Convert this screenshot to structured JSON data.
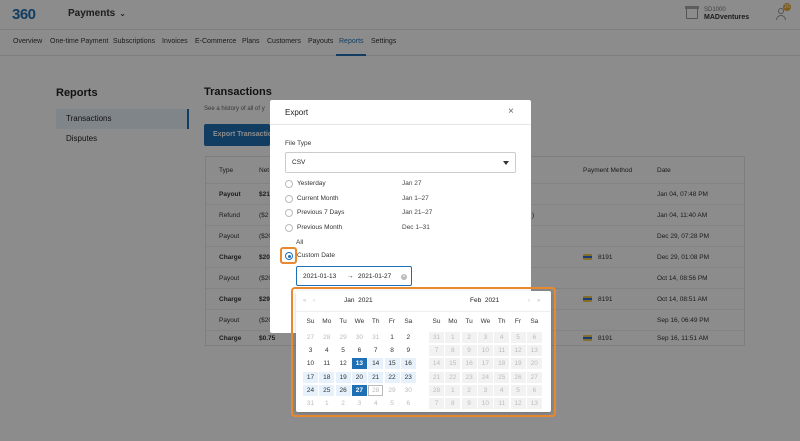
{
  "header": {
    "logo": "360",
    "app_name": "Payments",
    "account_id": "SD1000",
    "account_name": "MADventures",
    "notification_count": "20"
  },
  "nav": {
    "tabs": [
      "Overview",
      "One-time Payment",
      "Subscriptions",
      "Invoices",
      "E-Commerce",
      "Plans",
      "Customers",
      "Payouts",
      "Reports",
      "Settings"
    ],
    "active": "Reports"
  },
  "sidebar": {
    "title": "Reports",
    "items": [
      {
        "label": "Transactions"
      },
      {
        "label": "Disputes"
      }
    ]
  },
  "main": {
    "title": "Transactions",
    "subtitle": "See a history of all of y",
    "export_button": "Export Transactions"
  },
  "table": {
    "headers": [
      "Type",
      "Net",
      "Payment Method",
      "Date"
    ],
    "rows": [
      {
        "type": "Payout",
        "net": "$21",
        "pm": "",
        "date": "Jan 04, 07:48 PM",
        "bold": true
      },
      {
        "type": "Refund",
        "net": "($2",
        "pm": "",
        "date": "Jan 04, 11:40 AM",
        "bold": false,
        "extra": ")"
      },
      {
        "type": "Payout",
        "net": "($20",
        "pm": "",
        "date": "Dec 29, 07:28 PM",
        "bold": false
      },
      {
        "type": "Charge",
        "net": "$20",
        "pm": "8191",
        "date": "Dec 29, 01:08 PM",
        "bold": true
      },
      {
        "type": "Payout",
        "net": "($20",
        "pm": "",
        "date": "Oct 14, 08:56 PM",
        "bold": false
      },
      {
        "type": "Charge",
        "net": "$29",
        "pm": "8191",
        "date": "Oct 14, 08:51 AM",
        "bold": true
      },
      {
        "type": "Payout",
        "net": "($20",
        "pm": "",
        "date": "Sep 16, 06:49 PM",
        "bold": false
      },
      {
        "type": "Charge",
        "net": "$0.75",
        "pm": "8191",
        "date": "Sep 16, 11:51 AM",
        "bold": true
      }
    ]
  },
  "modal": {
    "title": "Export",
    "close": "×",
    "file_type_label": "File Type",
    "file_type_value": "CSV",
    "options": [
      {
        "label": "Yesterday",
        "range": "Jan 27"
      },
      {
        "label": "Current Month",
        "range": "Jan 1–27"
      },
      {
        "label": "Previous 7 Days",
        "range": "Jan 21–27"
      },
      {
        "label": "Previous Month",
        "range": "Dec 1–31"
      }
    ],
    "all_label": "All",
    "custom_label": "Custom Date",
    "date_start": "2021-01-13",
    "date_arrow": "→",
    "date_end": "2021-01-27"
  },
  "calendar": {
    "nav_prev_year": "«",
    "nav_prev": "‹",
    "nav_next": "›",
    "nav_next_year": "»",
    "left_month": "Jan",
    "left_year": "2021",
    "right_month": "Feb",
    "right_year": "2021",
    "weekdays": [
      "Su",
      "Mo",
      "Tu",
      "We",
      "Th",
      "Fr",
      "Sa"
    ],
    "left_days": [
      [
        "27",
        "28",
        "29",
        "30",
        "31",
        "1",
        "2"
      ],
      [
        "3",
        "4",
        "5",
        "6",
        "7",
        "8",
        "9"
      ],
      [
        "10",
        "11",
        "12",
        "13",
        "14",
        "15",
        "16"
      ],
      [
        "17",
        "18",
        "19",
        "20",
        "21",
        "22",
        "23"
      ],
      [
        "24",
        "25",
        "26",
        "27",
        "28",
        "29",
        "30"
      ],
      [
        "31",
        "1",
        "2",
        "3",
        "4",
        "5",
        "6"
      ]
    ],
    "right_days": [
      [
        "31",
        "1",
        "2",
        "3",
        "4",
        "5",
        "6"
      ],
      [
        "7",
        "8",
        "9",
        "10",
        "11",
        "12",
        "13"
      ],
      [
        "14",
        "15",
        "16",
        "17",
        "18",
        "19",
        "20"
      ],
      [
        "21",
        "22",
        "23",
        "24",
        "25",
        "26",
        "27"
      ],
      [
        "28",
        "1",
        "2",
        "3",
        "4",
        "5",
        "6"
      ],
      [
        "7",
        "8",
        "9",
        "10",
        "11",
        "12",
        "13"
      ]
    ]
  }
}
